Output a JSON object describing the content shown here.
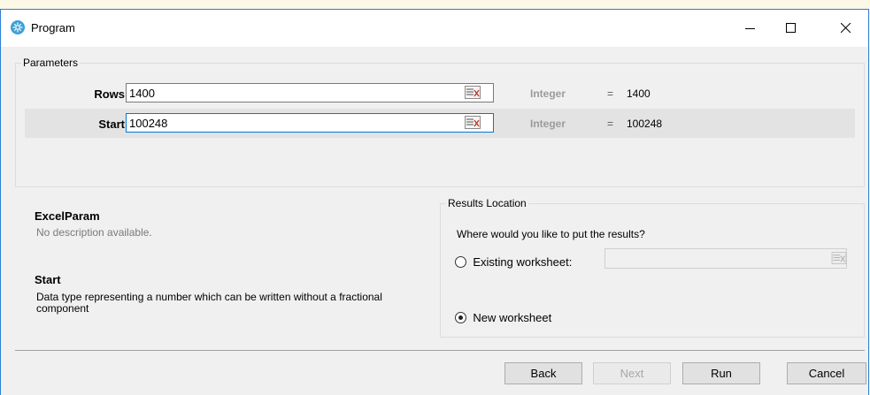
{
  "window": {
    "title": "Program"
  },
  "parameters": {
    "legend": "Parameters",
    "rows": [
      {
        "label": "Rows",
        "value": "1400",
        "type": "Integer",
        "equals": "=",
        "result": "1400"
      },
      {
        "label": "Start",
        "value": "100248",
        "type": "Integer",
        "equals": "=",
        "result": "100248"
      }
    ]
  },
  "description": {
    "title": "ExcelParam",
    "text": "No description available.",
    "param_title": "Start",
    "param_text": "Data type representing a number which can be written without a fractional component"
  },
  "results": {
    "legend": "Results Location",
    "question": "Where would you like to put the results?",
    "existing_label": "Existing worksheet:",
    "existing_value": "",
    "new_label": "New worksheet",
    "selected": "new"
  },
  "footer": {
    "back": "Back",
    "next": "Next",
    "run": "Run",
    "cancel": "Cancel"
  },
  "colors": {
    "window_border": "#2b7fd4",
    "focus_border": "#0078d7",
    "app_icon": "#3aa0d8"
  }
}
